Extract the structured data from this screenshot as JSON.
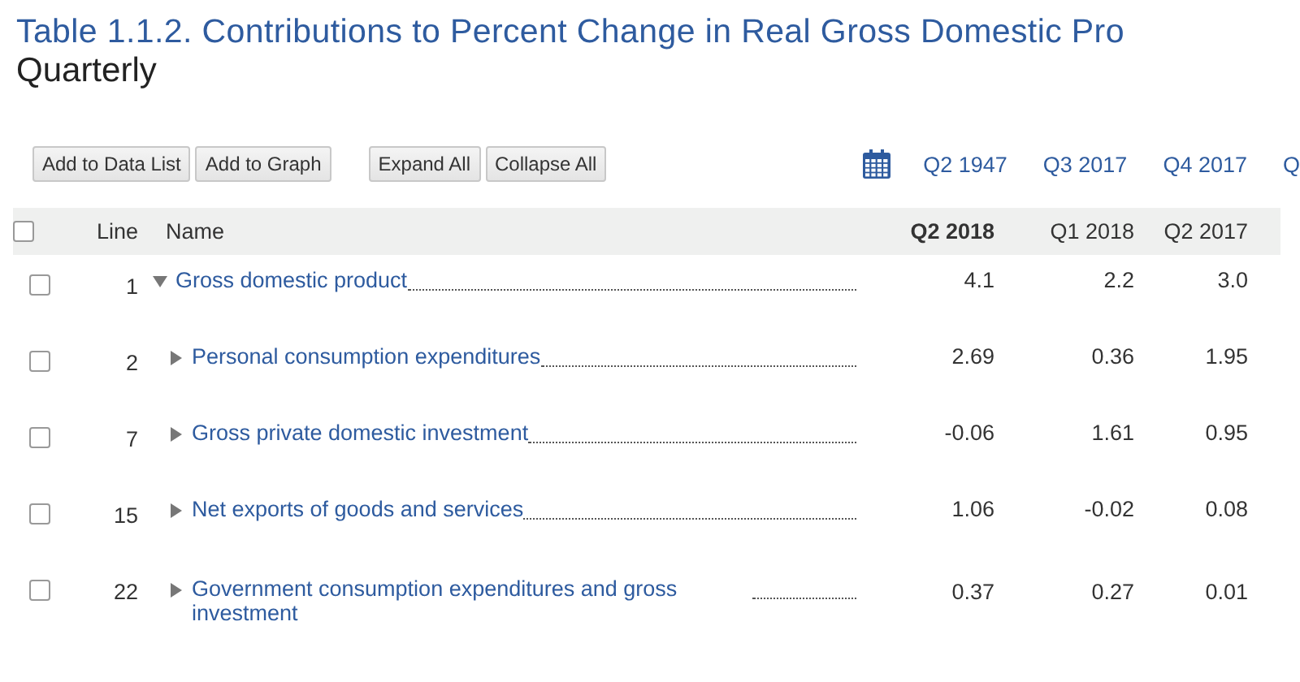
{
  "title": "Table 1.1.2. Contributions to Percent Change in Real Gross Domestic Pro",
  "subtitle": "Quarterly",
  "button_groups": [
    [
      "Add to Data List",
      "Add to Graph"
    ],
    [
      "Expand All",
      "Collapse All"
    ]
  ],
  "periods": [
    "Q2 1947",
    "Q3 2017",
    "Q4 2017",
    "Q"
  ],
  "table": {
    "select_all": {
      "checked": false
    },
    "columns": [
      {
        "label": "Line",
        "bold": false
      },
      {
        "label": "Name",
        "bold": false
      },
      {
        "label": "Q2 2018",
        "bold": true
      },
      {
        "label": "Q1 2018",
        "bold": false
      },
      {
        "label": "Q2 2017",
        "bold": false
      }
    ],
    "rows": [
      {
        "line": "1",
        "name": "Gross domestic product",
        "checked": false,
        "expanded": true,
        "values": [
          "4.1",
          "2.2",
          "3.0"
        ],
        "children": [
          {
            "line": "2",
            "name": "Personal consumption expenditures",
            "checked": false,
            "expanded": false,
            "values": [
              "2.69",
              "0.36",
              "1.95"
            ]
          },
          {
            "line": "7",
            "name": "Gross private domestic investment",
            "checked": false,
            "expanded": false,
            "values": [
              "-0.06",
              "1.61",
              "0.95"
            ]
          },
          {
            "line": "15",
            "name": "Net exports of goods and services",
            "checked": false,
            "expanded": false,
            "values": [
              "1.06",
              "-0.02",
              "0.08"
            ]
          },
          {
            "line": "22",
            "name": "Government consumption expenditures and gross investment",
            "checked": false,
            "expanded": false,
            "values": [
              "0.37",
              "0.27",
              "0.01"
            ]
          }
        ]
      }
    ]
  }
}
